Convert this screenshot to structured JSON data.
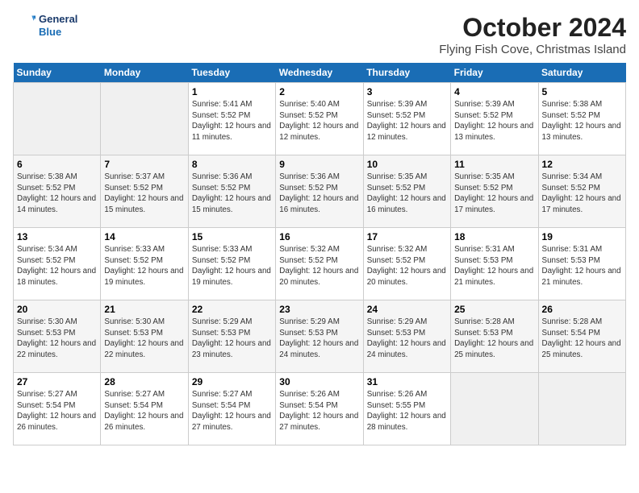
{
  "header": {
    "logo_line1": "General",
    "logo_line2": "Blue",
    "month": "October 2024",
    "location": "Flying Fish Cove, Christmas Island"
  },
  "weekdays": [
    "Sunday",
    "Monday",
    "Tuesday",
    "Wednesday",
    "Thursday",
    "Friday",
    "Saturday"
  ],
  "weeks": [
    [
      {
        "day": "",
        "empty": true
      },
      {
        "day": "",
        "empty": true
      },
      {
        "day": "1",
        "sunrise": "5:41 AM",
        "sunset": "5:52 PM",
        "daylight": "12 hours and 11 minutes."
      },
      {
        "day": "2",
        "sunrise": "5:40 AM",
        "sunset": "5:52 PM",
        "daylight": "12 hours and 12 minutes."
      },
      {
        "day": "3",
        "sunrise": "5:39 AM",
        "sunset": "5:52 PM",
        "daylight": "12 hours and 12 minutes."
      },
      {
        "day": "4",
        "sunrise": "5:39 AM",
        "sunset": "5:52 PM",
        "daylight": "12 hours and 13 minutes."
      },
      {
        "day": "5",
        "sunrise": "5:38 AM",
        "sunset": "5:52 PM",
        "daylight": "12 hours and 13 minutes."
      }
    ],
    [
      {
        "day": "6",
        "sunrise": "5:38 AM",
        "sunset": "5:52 PM",
        "daylight": "12 hours and 14 minutes."
      },
      {
        "day": "7",
        "sunrise": "5:37 AM",
        "sunset": "5:52 PM",
        "daylight": "12 hours and 15 minutes."
      },
      {
        "day": "8",
        "sunrise": "5:36 AM",
        "sunset": "5:52 PM",
        "daylight": "12 hours and 15 minutes."
      },
      {
        "day": "9",
        "sunrise": "5:36 AM",
        "sunset": "5:52 PM",
        "daylight": "12 hours and 16 minutes."
      },
      {
        "day": "10",
        "sunrise": "5:35 AM",
        "sunset": "5:52 PM",
        "daylight": "12 hours and 16 minutes."
      },
      {
        "day": "11",
        "sunrise": "5:35 AM",
        "sunset": "5:52 PM",
        "daylight": "12 hours and 17 minutes."
      },
      {
        "day": "12",
        "sunrise": "5:34 AM",
        "sunset": "5:52 PM",
        "daylight": "12 hours and 17 minutes."
      }
    ],
    [
      {
        "day": "13",
        "sunrise": "5:34 AM",
        "sunset": "5:52 PM",
        "daylight": "12 hours and 18 minutes."
      },
      {
        "day": "14",
        "sunrise": "5:33 AM",
        "sunset": "5:52 PM",
        "daylight": "12 hours and 19 minutes."
      },
      {
        "day": "15",
        "sunrise": "5:33 AM",
        "sunset": "5:52 PM",
        "daylight": "12 hours and 19 minutes."
      },
      {
        "day": "16",
        "sunrise": "5:32 AM",
        "sunset": "5:52 PM",
        "daylight": "12 hours and 20 minutes."
      },
      {
        "day": "17",
        "sunrise": "5:32 AM",
        "sunset": "5:52 PM",
        "daylight": "12 hours and 20 minutes."
      },
      {
        "day": "18",
        "sunrise": "5:31 AM",
        "sunset": "5:53 PM",
        "daylight": "12 hours and 21 minutes."
      },
      {
        "day": "19",
        "sunrise": "5:31 AM",
        "sunset": "5:53 PM",
        "daylight": "12 hours and 21 minutes."
      }
    ],
    [
      {
        "day": "20",
        "sunrise": "5:30 AM",
        "sunset": "5:53 PM",
        "daylight": "12 hours and 22 minutes."
      },
      {
        "day": "21",
        "sunrise": "5:30 AM",
        "sunset": "5:53 PM",
        "daylight": "12 hours and 22 minutes."
      },
      {
        "day": "22",
        "sunrise": "5:29 AM",
        "sunset": "5:53 PM",
        "daylight": "12 hours and 23 minutes."
      },
      {
        "day": "23",
        "sunrise": "5:29 AM",
        "sunset": "5:53 PM",
        "daylight": "12 hours and 24 minutes."
      },
      {
        "day": "24",
        "sunrise": "5:29 AM",
        "sunset": "5:53 PM",
        "daylight": "12 hours and 24 minutes."
      },
      {
        "day": "25",
        "sunrise": "5:28 AM",
        "sunset": "5:53 PM",
        "daylight": "12 hours and 25 minutes."
      },
      {
        "day": "26",
        "sunrise": "5:28 AM",
        "sunset": "5:54 PM",
        "daylight": "12 hours and 25 minutes."
      }
    ],
    [
      {
        "day": "27",
        "sunrise": "5:27 AM",
        "sunset": "5:54 PM",
        "daylight": "12 hours and 26 minutes."
      },
      {
        "day": "28",
        "sunrise": "5:27 AM",
        "sunset": "5:54 PM",
        "daylight": "12 hours and 26 minutes."
      },
      {
        "day": "29",
        "sunrise": "5:27 AM",
        "sunset": "5:54 PM",
        "daylight": "12 hours and 27 minutes."
      },
      {
        "day": "30",
        "sunrise": "5:26 AM",
        "sunset": "5:54 PM",
        "daylight": "12 hours and 27 minutes."
      },
      {
        "day": "31",
        "sunrise": "5:26 AM",
        "sunset": "5:55 PM",
        "daylight": "12 hours and 28 minutes."
      },
      {
        "day": "",
        "empty": true
      },
      {
        "day": "",
        "empty": true
      }
    ]
  ],
  "labels": {
    "sunrise_prefix": "Sunrise: ",
    "sunset_prefix": "Sunset: ",
    "daylight_prefix": "Daylight: "
  }
}
